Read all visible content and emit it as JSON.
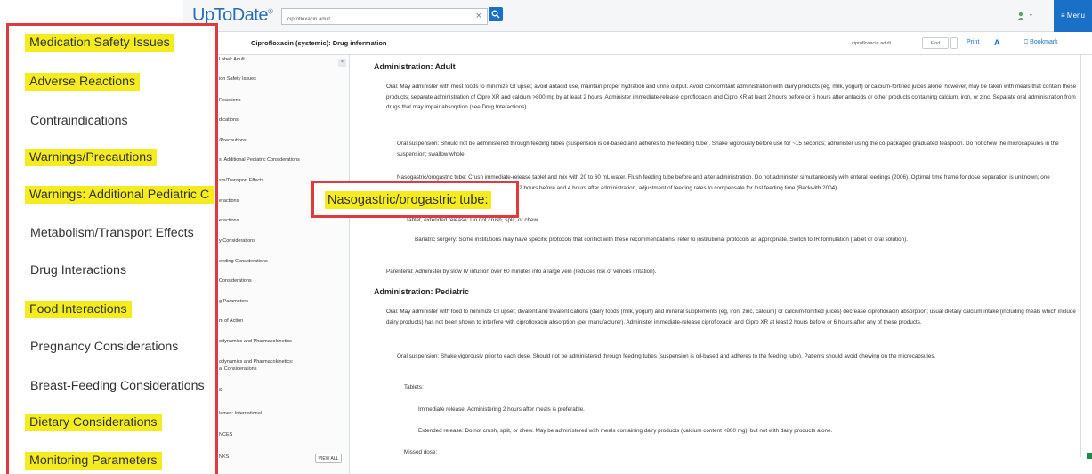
{
  "header": {
    "logo_text": "UpToDate",
    "logo_mark": "®",
    "search_value": "ciprofloxacin adult",
    "search_clear": "×",
    "menu_label": "Menu"
  },
  "titlebar": {
    "doc_title": "Ciprofloxacin (systemic): Drug information",
    "find_value": "ciprofloxacin adult",
    "find_button": "Find",
    "print_label": "Print",
    "font_icon": "A",
    "bookmark_label": "Bookmark"
  },
  "toc": {
    "top_label": "Label: Adult",
    "close": "×",
    "view_all": "VIEW ALL",
    "items": [
      "ion Safety Issues",
      "Reactions",
      "dications",
      "/Precautions",
      "s: Additional Pediatric Considerations",
      "sm/Transport Effects",
      "eractions",
      "eractions",
      "y Considerations",
      "eeding Considerations",
      "Considerations",
      "g Parameters",
      "m of Action",
      "odynamics and Pharmacokinetics",
      "odynamics and Pharmacokinetics:",
      "al Considerations",
      "S",
      "lames: International",
      "NCES",
      "NKS"
    ]
  },
  "content": {
    "admin_adult": {
      "heading": "Administration: Adult",
      "oral": "Oral: May administer with most foods to minimize GI upset; avoid antacid use, maintain proper hydration and urine output. Avoid concomitant administration with dairy products (eg, milk, yogurt) or calcium-fortified juices alone, however, may be taken with meals that contain these products; separate administration of Cipro XR and calcium >800 mg by at least 2 hours. Administer immediate-release ciprofloxacin and Cipro XR at least 2 hours before or 6 hours after antacids or other products containing calcium, iron, or zinc. Separate oral administration from drugs that may impair absorption (see Drug Interactions).",
      "oral_suspension": "Oral suspension: Should not be administered through feeding tubes (suspension is oil-based and adheres to the feeding tube). Shake vigorously before use for ~15 seconds; administer using the co-packaged graduated teaspoon. Do not chew the microcapsules in the suspension; swallow whole.",
      "ng_tube": "Nasogastric/orogastric tube: Crush immediate-release tablet and mix with 20 to 60 mL water. Flush feeding tube before and after administration. Do not administer simultaneously with enteral feedings (2006). Optimal time frame for dose separation is unknown; one recommendation is to hold tube feedings at least 2 hours before and 4 hours after administration, adjustment of feeding rates to compensate for lost feeding time (Beckwith 2004).",
      "tablet_er": "Tablet, extended release: Do not crush, split, or chew.",
      "bariatric": "Bariatric surgery: Some institutions may have specific protocols that conflict with these recommendations; refer to institutional protocols as appropriate. Switch to IR formulation (tablet or oral solution).",
      "parenteral": "Parenteral: Administer by slow IV infusion over 60 minutes into a large vein (reduces risk of venous irritation)."
    },
    "admin_peds": {
      "heading": "Administration: Pediatric",
      "oral": "Oral: May administer with food to minimize GI upset; divalent and trivalent cations (dairy foods (milk, yogurt) and mineral supplements (eg, iron, zinc, calcium) or calcium-fortified juices) decrease ciprofloxacin absorption; usual dietary calcium intake (including meals which include dairy products) has not been shown to interfere with ciprofloxacin absorption (per manufacturer). Administer immediate-release ciprofloxacin and Cipro XR at least 2 hours before or 6 hours after any of these products.",
      "oral_suspension": "Oral suspension: Shake vigorously prior to each dose. Should not be administered through feeding tubes (suspension is oil-based and adheres to the feeding tube). Patients should avoid chewing on the microcapsules.",
      "tablets_label": "Tablets:",
      "immediate": "Immediate release: Administering 2 hours after meals is preferable.",
      "extended": "Extended release: Do not crush, split, or chew. May be administered with meals containing dairy products (calcium content <800 mg), but not with dairy products alone.",
      "missed": "Missed dose:"
    }
  },
  "zoom_panel": {
    "items": [
      {
        "label": "Medication Safety Issues",
        "highlight": true
      },
      {
        "label": "Adverse Reactions",
        "highlight": true
      },
      {
        "label": "Contraindications",
        "highlight": false
      },
      {
        "label": "Warnings/Precautions",
        "highlight": true
      },
      {
        "label": "Warnings: Additional Pediatric C",
        "highlight": true
      },
      {
        "label": "Metabolism/Transport Effects",
        "highlight": false
      },
      {
        "label": "Drug Interactions",
        "highlight": false
      },
      {
        "label": "Food Interactions",
        "highlight": true
      },
      {
        "label": "Pregnancy Considerations",
        "highlight": false
      },
      {
        "label": "Breast-Feeding Considerations",
        "highlight": false
      },
      {
        "label": "Dietary Considerations",
        "highlight": true
      },
      {
        "label": "Monitoring Parameters",
        "highlight": true
      }
    ],
    "highlight_color": "#f5ec1f",
    "border_color": "#e03a3e"
  },
  "callout": {
    "label": "Nasogastric/orogastric tube:"
  }
}
